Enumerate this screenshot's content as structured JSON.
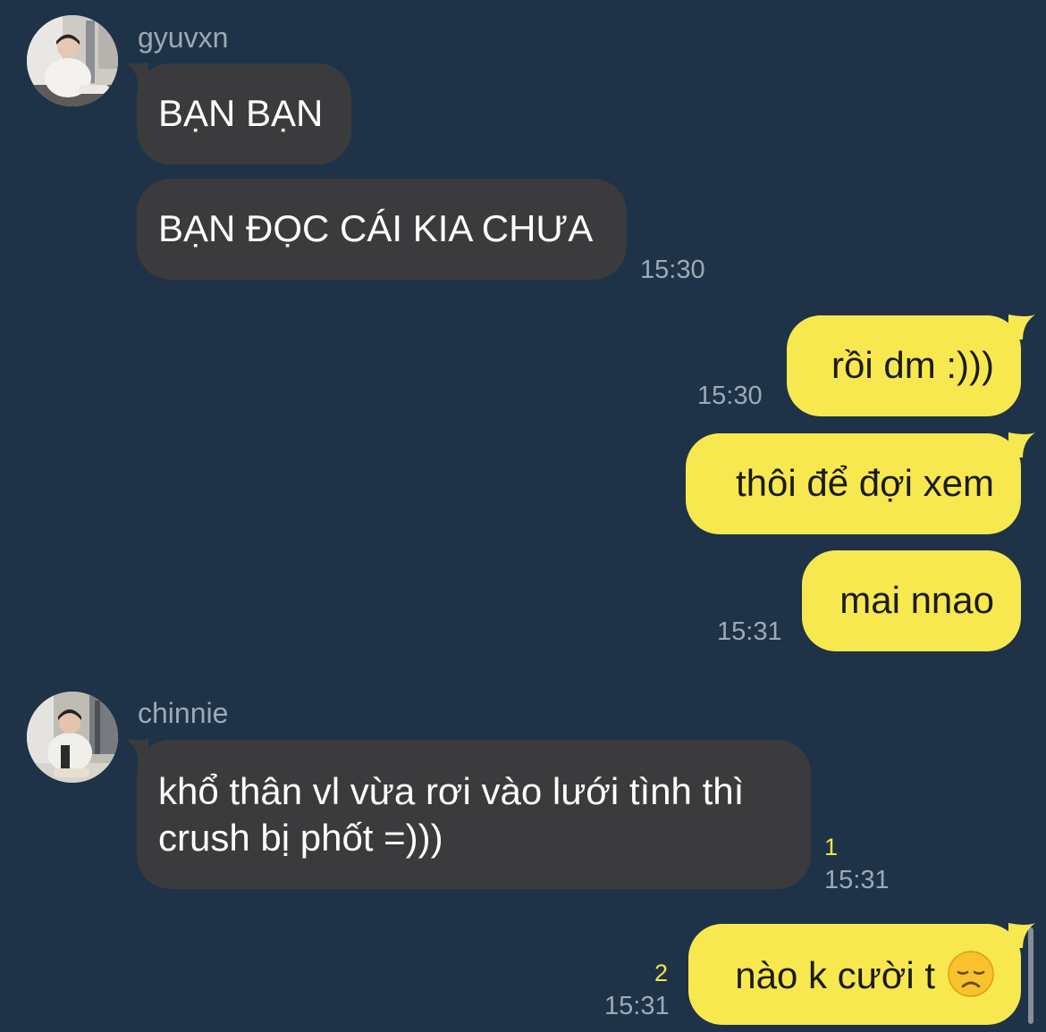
{
  "chat": {
    "group1": {
      "sender": "gyuvxn",
      "messages": [
        "BẠN BẠN",
        "BẠN ĐỌC CÁI KIA CHƯA"
      ],
      "time": "15:30"
    },
    "reply1": {
      "messages": [
        "rồi dm :)))"
      ],
      "time": "15:30"
    },
    "reply2": {
      "messages": [
        "thôi để đợi xem",
        "mai nnao"
      ],
      "time": "15:31"
    },
    "group2": {
      "sender": "chinnie",
      "message_lines": [
        "khổ thân vl vừa rơi vào lưới tình thì",
        "crush bị phốt =)))"
      ],
      "unread_count": "1",
      "time": "15:31"
    },
    "reply3": {
      "message": "nào k cười t",
      "emoji": "disappointed-face-icon",
      "unread_count": "2",
      "time": "15:31"
    }
  },
  "colors": {
    "background": "#1e3348",
    "incoming_bubble": "#3b3b3d",
    "outgoing_bubble": "#f8e84f",
    "meta_text": "#9ea9b4",
    "unread_count": "#f3e44a"
  }
}
